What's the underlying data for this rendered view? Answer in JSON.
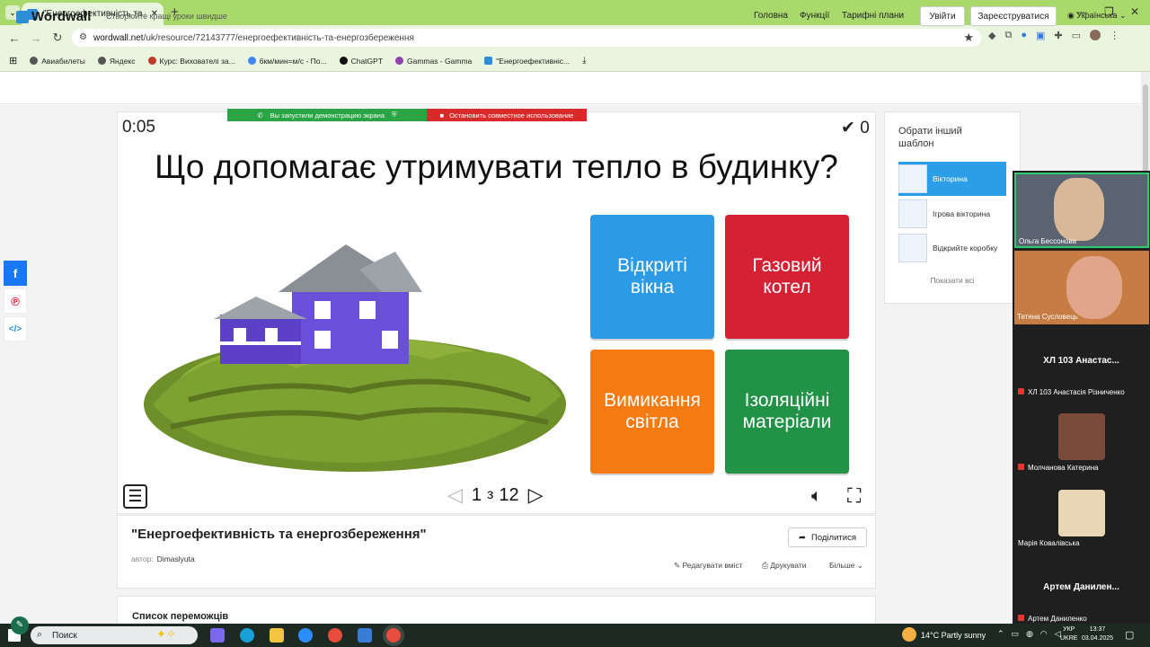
{
  "browser": {
    "tab_title": "\"Енергоефективність та енерг",
    "url_host": "wordwall.net",
    "url_path": "/uk/resource/72143777/енергоефективність-та-енергозбереження",
    "bookmarks": [
      "Авиабилеты",
      "Яндекс",
      "Курс: Вихователі за...",
      "6км/мин=м/с - По...",
      "ChatGPT",
      "Gammas - Gamma",
      "\"Енергоефективніс..."
    ]
  },
  "header": {
    "logo": "Wordwall",
    "tagline": "Створюйте кращі уроки швидше",
    "nav": [
      "Головна",
      "Функції",
      "Тарифні плани"
    ],
    "login": "Увійти",
    "register": "Зареєструватися",
    "language": "Українська"
  },
  "share_banner": {
    "active": "Вы запустили демонстрацию экрана",
    "stop": "Остановить совместное использование"
  },
  "game": {
    "timer": "0:05",
    "score": "0",
    "question": "Що допомагає утримувати тепло в будинку?",
    "answers": [
      {
        "line1": "Відкриті",
        "line2": "вікна",
        "color": "#2d9ae6"
      },
      {
        "line1": "Газовий",
        "line2": "котел",
        "color": "#d62033"
      },
      {
        "line1": "Вимикання",
        "line2": "світла",
        "color": "#f57a12"
      },
      {
        "line1": "Ізоляційні",
        "line2": "матеріали",
        "color": "#229247"
      }
    ],
    "page_current": "1",
    "page_sep": "з",
    "page_total": "12"
  },
  "resource": {
    "title": "\"Енергоефективність та енергозбереження\"",
    "author_label": "автор:",
    "author": "Dimaslyuta",
    "share": "Поділитися",
    "edit": "Редагувати вміст",
    "print": "Друкувати",
    "more": "Більше",
    "winners": "Список переможців"
  },
  "templates": {
    "title": "Обрати інший шаблон",
    "items": [
      "Вікторина",
      "Ігрова вікторина",
      "Відкрийте коробку"
    ],
    "more": "Показати всі"
  },
  "participants": [
    {
      "name": "Ольга Бессонова"
    },
    {
      "name": "Тетяна Сусловець"
    },
    {
      "big": "ХЛ 103 Анастас...",
      "name": "ХЛ 103 Анастасія Різниченко"
    },
    {
      "name": "Молчанова Катерина"
    },
    {
      "name": "Марія Ковалівська"
    },
    {
      "big": "Артем  Данилен...",
      "name": "Артем Даниленко"
    }
  ],
  "taskbar": {
    "search": "Поиск",
    "weather": "14°C  Partly sunny",
    "lang1": "УКР",
    "lang2": "UKRE",
    "time": "13:37",
    "date": "03.04.2025"
  },
  "colors": {
    "brand": "#2c8fd8",
    "chrome": "#a8d96a"
  }
}
